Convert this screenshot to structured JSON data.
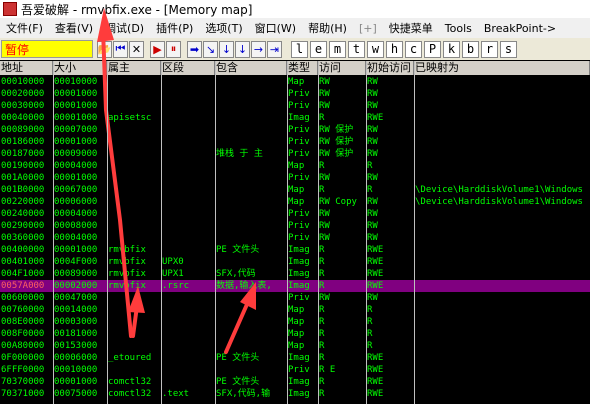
{
  "window": {
    "title": "吾爱破解 - rmvbfix.exe - [Memory map]"
  },
  "menu": [
    "文件(F)",
    "查看(V)",
    "调试(D)",
    "插件(P)",
    "选项(T)",
    "窗口(W)",
    "帮助(H)",
    "[+]",
    "快捷菜单",
    "Tools",
    "BreakPoint->"
  ],
  "toolbar": {
    "status": "暂停",
    "buttons": [
      "📂",
      "⏮",
      "✕",
      "▶",
      "⏸",
      "➡",
      "↘",
      "↓",
      "↓",
      "→",
      "⇥"
    ],
    "letters": [
      "l",
      "e",
      "m",
      "t",
      "w",
      "h",
      "c",
      "P",
      "k",
      "b",
      "r",
      "s"
    ]
  },
  "columns": [
    "地址",
    "大小",
    "属主",
    "区段",
    "包含",
    "类型",
    "访问",
    "初始访问",
    "已映射为"
  ],
  "rows": [
    [
      "00010000",
      "00010000",
      "",
      "",
      "",
      "Map",
      "RW",
      "RW",
      ""
    ],
    [
      "00020000",
      "00001000",
      "",
      "",
      "",
      "Priv",
      "RW",
      "RW",
      ""
    ],
    [
      "00030000",
      "00001000",
      "",
      "",
      "",
      "Priv",
      "RW",
      "RW",
      ""
    ],
    [
      "00040000",
      "00001000",
      "apisetsc",
      "",
      "",
      "Imag",
      "R",
      "RWE",
      ""
    ],
    [
      "00089000",
      "00007000",
      "",
      "",
      "",
      "Priv",
      "RW  保护",
      "RW",
      ""
    ],
    [
      "00186000",
      "00001000",
      "",
      "",
      "",
      "Priv",
      "RW  保护",
      "RW",
      ""
    ],
    [
      "00187000",
      "00009000",
      "",
      "",
      "堆栈 于  主",
      "Priv",
      "RW  保护",
      "RW",
      ""
    ],
    [
      "00190000",
      "00004000",
      "",
      "",
      "",
      "Map",
      "R",
      "R",
      ""
    ],
    [
      "001A0000",
      "00001000",
      "",
      "",
      "",
      "Priv",
      "RW",
      "RW",
      ""
    ],
    [
      "001B0000",
      "00067000",
      "",
      "",
      "",
      "Map",
      "R",
      "R",
      "\\Device\\HarddiskVolume1\\Windows"
    ],
    [
      "00220000",
      "00006000",
      "",
      "",
      "",
      "Map",
      "RW  Copy",
      "RW",
      "\\Device\\HarddiskVolume1\\Windows"
    ],
    [
      "00240000",
      "00004000",
      "",
      "",
      "",
      "Priv",
      "RW",
      "RW",
      ""
    ],
    [
      "00290000",
      "00008000",
      "",
      "",
      "",
      "Priv",
      "RW",
      "RW",
      ""
    ],
    [
      "00360000",
      "00004000",
      "",
      "",
      "",
      "Priv",
      "RW",
      "RW",
      ""
    ],
    [
      "00400000",
      "00001000",
      "rmvbfix",
      "",
      "PE 文件头",
      "Imag",
      "R",
      "RWE",
      ""
    ],
    [
      "00401000",
      "0004F000",
      "rmvbfix",
      "UPX0",
      "",
      "Imag",
      "R",
      "RWE",
      ""
    ],
    [
      "004F1000",
      "00089000",
      "rmvbfix",
      "UPX1",
      "SFX,代码",
      "Imag",
      "R",
      "RWE",
      ""
    ],
    [
      "0057A000",
      "00002000",
      "rmvbfix",
      ".rsrc",
      "数据,输入表,",
      "Imag",
      "R",
      "RWE",
      ""
    ],
    [
      "00600000",
      "00047000",
      "",
      "",
      "",
      "Priv",
      "RW",
      "RW",
      ""
    ],
    [
      "00760000",
      "00014000",
      "",
      "",
      "",
      "Map",
      "R",
      "R",
      ""
    ],
    [
      "008E0000",
      "00003000",
      "",
      "",
      "",
      "Map",
      "R",
      "R",
      ""
    ],
    [
      "008F0000",
      "00181000",
      "",
      "",
      "",
      "Map",
      "R",
      "R",
      ""
    ],
    [
      "00A80000",
      "00153000",
      "",
      "",
      "",
      "Map",
      "R",
      "R",
      ""
    ],
    [
      "0F000000",
      "00006000",
      "_etoured",
      "",
      "PE 文件头",
      "Imag",
      "R",
      "RWE",
      ""
    ],
    [
      "6FFF0000",
      "00010000",
      "",
      "",
      "",
      "Priv",
      "R E",
      "RWE",
      ""
    ],
    [
      "70370000",
      "00001000",
      "comctl32",
      "",
      "PE 文件头",
      "Imag",
      "R",
      "RWE",
      ""
    ],
    [
      "70371000",
      "00075000",
      "comctl32",
      ".text",
      "SFX,代码,输",
      "Imag",
      "R",
      "RWE",
      ""
    ]
  ],
  "selected_row": 17,
  "colors": {
    "text": "#00ff00",
    "background": "#000000",
    "selection": "#800080",
    "selected_address": "#ff6060",
    "annotation_arrow": "#ff3c3c"
  }
}
